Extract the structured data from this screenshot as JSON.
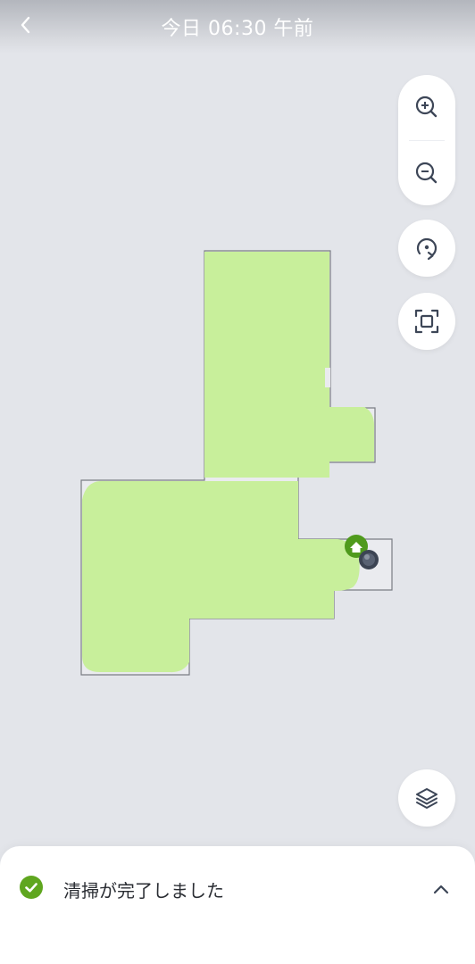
{
  "header": {
    "title": "今日 06:30 午前",
    "back_icon": "chevron-left-icon"
  },
  "map": {
    "floor_color": "#eaebef",
    "cleaned_color": "#c8ef9b",
    "wall_color": "#7a7d84",
    "dock_color": "#4f9a1c",
    "robot_color": "#3c4453"
  },
  "controls": {
    "zoom_in_icon": "zoom-in-icon",
    "zoom_out_icon": "zoom-out-icon",
    "rotate_icon": "rotate-icon",
    "fit_icon": "fit-screen-icon",
    "layers_icon": "layers-icon"
  },
  "status": {
    "text": "清掃が完了しました",
    "check_color": "#5fa61f",
    "expand_icon": "chevron-up-icon"
  }
}
